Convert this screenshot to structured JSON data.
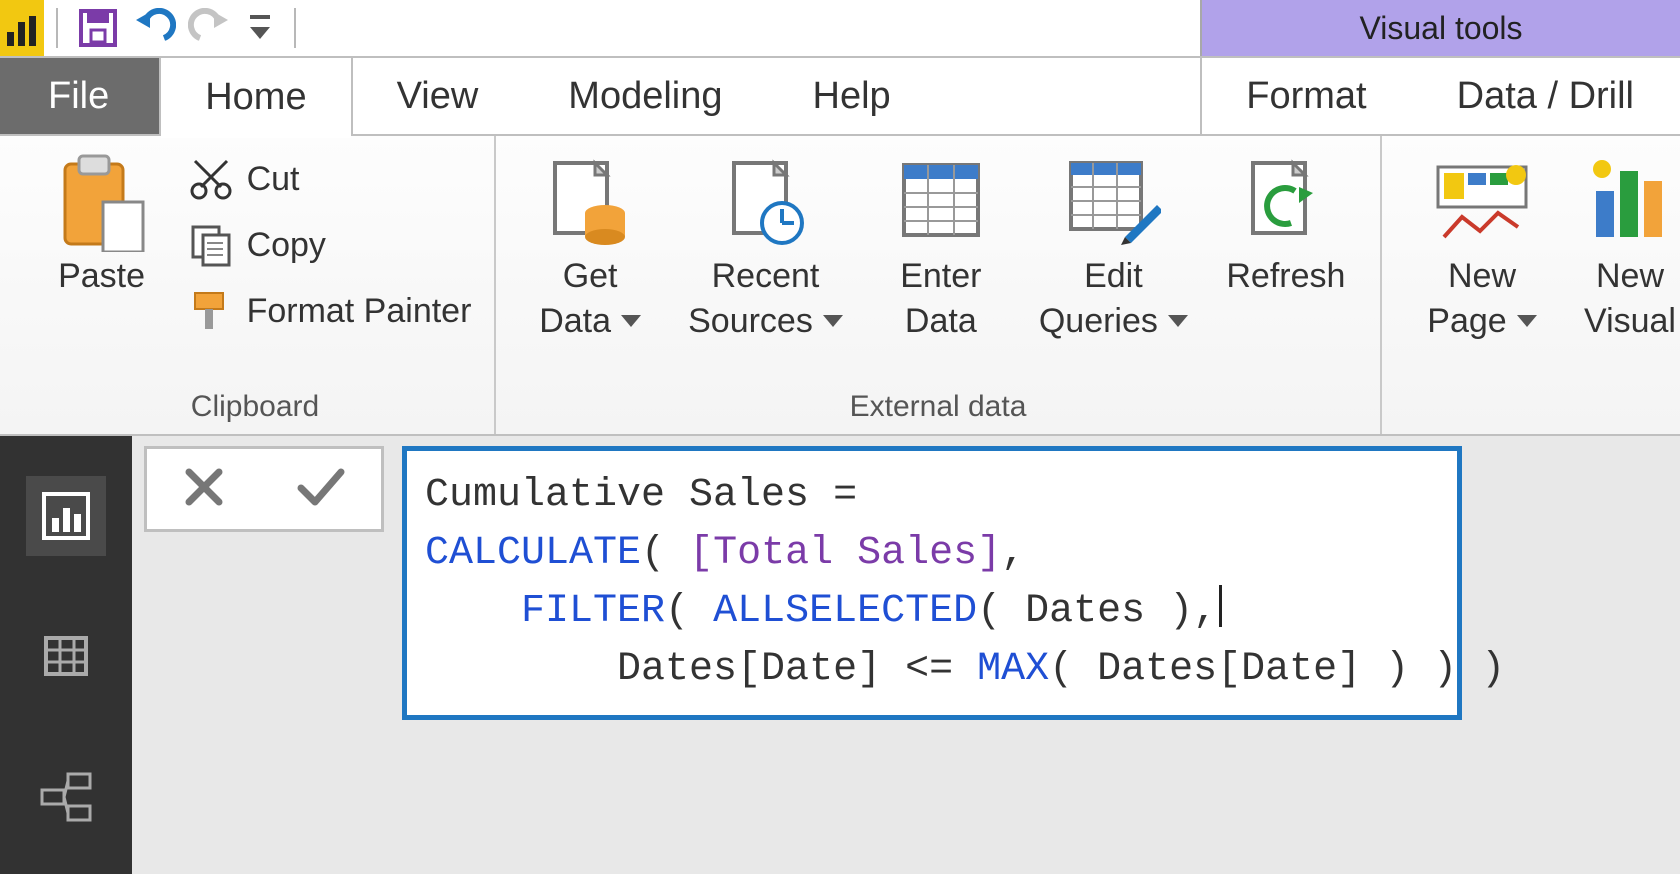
{
  "qat": {
    "logo_name": "powerbi-logo",
    "visual_tools": "Visual tools"
  },
  "tabs": {
    "file": "File",
    "home": "Home",
    "view": "View",
    "modeling": "Modeling",
    "help": "Help",
    "format": "Format",
    "datadrill": "Data / Drill"
  },
  "ribbon": {
    "clipboard": {
      "group": "Clipboard",
      "paste": "Paste",
      "cut": "Cut",
      "copy": "Copy",
      "fpaint": "Format Painter"
    },
    "external": {
      "group": "External data",
      "getdata1": "Get",
      "getdata2": "Data",
      "recent1": "Recent",
      "recent2": "Sources",
      "enter1": "Enter",
      "enter2": "Data",
      "editq1": "Edit",
      "editq2": "Queries",
      "refresh": "Refresh"
    },
    "insert": {
      "newpage1": "New",
      "newpage2": "Page",
      "newvis1": "New",
      "newvis2": "Visual"
    }
  },
  "formula": {
    "line1_pre": "Cumulative Sales = ",
    "calc": "CALCULATE",
    "p_open": "( ",
    "measure": "[Total Sales]",
    "comma": ",",
    "filter": "FILTER",
    "allsel": "ALLSELECTED",
    "dates_arg": "( Dates ),",
    "line3_pre": "        Dates[Date] <= ",
    "max": "MAX",
    "line3_post": "( Dates[Date] ) ) )"
  }
}
